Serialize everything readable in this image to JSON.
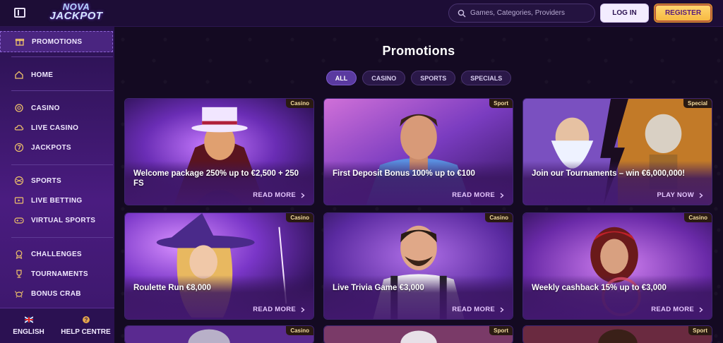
{
  "header": {
    "logo_line1": "NOVA",
    "logo_line2": "JACKPOT",
    "search_placeholder": "Games, Categories, Providers",
    "login_label": "LOG IN",
    "register_label": "REGISTER"
  },
  "sidebar": {
    "items": [
      {
        "label": "PROMOTIONS",
        "icon": "gift-icon",
        "active": true
      },
      {
        "label": "HOME",
        "icon": "home-icon"
      },
      {
        "label": "CASINO",
        "icon": "casino-chip-icon"
      },
      {
        "label": "LIVE CASINO",
        "icon": "cloud-icon"
      },
      {
        "label": "JACKPOTS",
        "icon": "seven-icon"
      },
      {
        "label": "SPORTS",
        "icon": "ball-icon"
      },
      {
        "label": "LIVE BETTING",
        "icon": "tv-icon"
      },
      {
        "label": "VIRTUAL SPORTS",
        "icon": "gamepad-icon"
      },
      {
        "label": "CHALLENGES",
        "icon": "medal-icon"
      },
      {
        "label": "TOURNAMENTS",
        "icon": "trophy-icon"
      },
      {
        "label": "BONUS CRAB",
        "icon": "crab-icon"
      }
    ],
    "bottom": {
      "language_label": "ENGLISH",
      "help_label": "HELP CENTRE"
    }
  },
  "main": {
    "title": "Promotions",
    "filters": [
      "ALL",
      "CASINO",
      "SPORTS",
      "SPECIALS"
    ],
    "cards": [
      {
        "tag": "Casino",
        "title": "Welcome package 250% up to €2,500 + 250 FS",
        "cta": "READ MORE"
      },
      {
        "tag": "Sport",
        "title": "First Deposit Bonus 100% up to €100",
        "cta": "READ MORE"
      },
      {
        "tag": "Special",
        "title": "Join our Tournaments – win €6,000,000!",
        "cta": "PLAY NOW"
      },
      {
        "tag": "Casino",
        "title": "Roulette Run €8,000",
        "cta": "READ MORE"
      },
      {
        "tag": "Casino",
        "title": "Live Trivia Game €3,000",
        "cta": "READ MORE"
      },
      {
        "tag": "Casino",
        "title": "Weekly cashback 15% up to €3,000",
        "cta": "READ MORE"
      },
      {
        "tag": "Casino"
      },
      {
        "tag": "Sport"
      },
      {
        "tag": "Sport"
      }
    ]
  },
  "colors": {
    "background": "#140a22",
    "sidebar": "#3a1768",
    "accent_gold": "#f7b73e",
    "accent_purple": "#5a3aa0"
  }
}
